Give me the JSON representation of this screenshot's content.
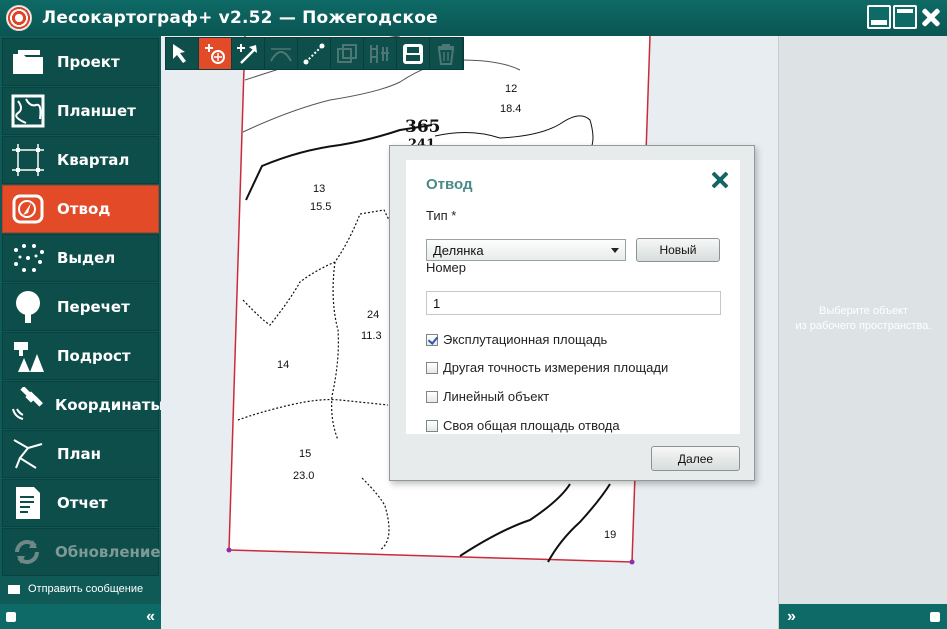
{
  "window": {
    "title": "Лесокартограф+ v2.52  —  Пожегодское",
    "icon": "app-logo-icon"
  },
  "sidebar": {
    "items": [
      {
        "label": "Проект",
        "icon": "folder-icon",
        "active": false
      },
      {
        "label": "Планшет",
        "icon": "tablet-map-icon",
        "active": false
      },
      {
        "label": "Квартал",
        "icon": "quarter-grid-icon",
        "active": false
      },
      {
        "label": "Отвод",
        "icon": "allotment-compass-icon",
        "active": true
      },
      {
        "label": "Выдел",
        "icon": "plot-dots-icon",
        "active": false
      },
      {
        "label": "Перечет",
        "icon": "tree-icon",
        "active": false
      },
      {
        "label": "Подрост",
        "icon": "young-trees-icon",
        "active": false
      },
      {
        "label": "Координаты",
        "icon": "satellite-icon",
        "active": false
      },
      {
        "label": "План",
        "icon": "plan-lines-icon",
        "active": false
      },
      {
        "label": "Отчет",
        "icon": "report-document-icon",
        "active": false
      },
      {
        "label": "Обновление",
        "icon": "update-icon",
        "active": false,
        "disabled": true
      }
    ],
    "send_message": "Отправить сообщение",
    "collapse": "«"
  },
  "toolbar": {
    "tools": [
      {
        "name": "select-arrow-icon",
        "selected": false
      },
      {
        "name": "add-point-icon",
        "selected": true
      },
      {
        "name": "add-vertex-arrow-icon",
        "selected": false
      },
      {
        "name": "arc-tool-icon",
        "selected": false
      },
      {
        "name": "measure-line-icon",
        "selected": false
      },
      {
        "name": "copy-layer-icon",
        "selected": false
      },
      {
        "name": "grid-edit-icon",
        "selected": false
      },
      {
        "name": "print-icon",
        "selected": false
      },
      {
        "name": "delete-trash-icon",
        "selected": false
      }
    ]
  },
  "map": {
    "labels": {
      "quarter_number": "365",
      "quarter_sub": "241",
      "plot_12": "12",
      "plot_12_area": "18.4",
      "plot_13": "13",
      "plot_13_area": "15.5",
      "plot_24": "24",
      "plot_24_area": "11.3",
      "plot_14": "14",
      "plot_15": "15",
      "plot_15_area": "23.0",
      "plot_19": "19"
    }
  },
  "dialog": {
    "title": "Отвод",
    "type_label": "Тип *",
    "type_value": "Делянка",
    "new_button": "Новый",
    "number_label": "Номер",
    "number_value": "1",
    "options": [
      {
        "label": "Эксплутационная площадь",
        "checked": true
      },
      {
        "label": "Другая точность измерения площади",
        "checked": false
      },
      {
        "label": "Линейный объект",
        "checked": false
      },
      {
        "label": "Своя общая площадь отвода",
        "checked": false
      }
    ],
    "next_button": "Далее"
  },
  "right_panel": {
    "hint_line1": "Выберите объект",
    "hint_line2": "из рабочего пространства.",
    "expand": "»"
  }
}
